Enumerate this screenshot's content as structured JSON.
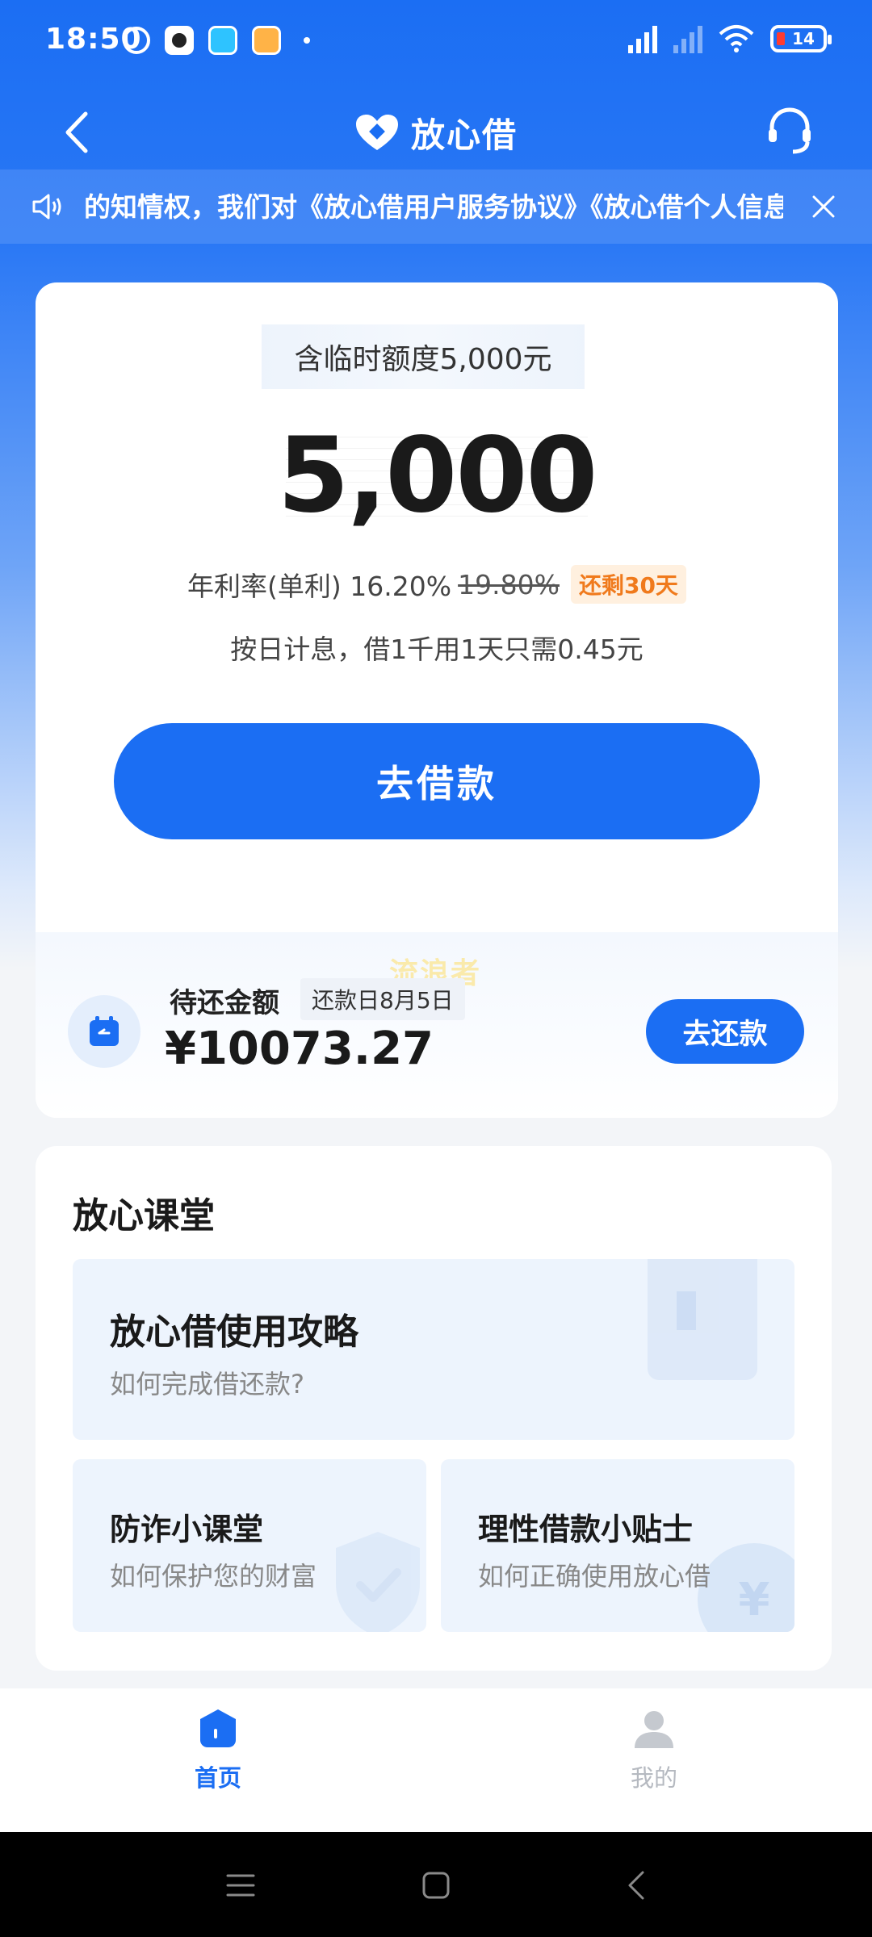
{
  "status_bar": {
    "time": "18:50",
    "battery": "14"
  },
  "nav": {
    "title": "放心借"
  },
  "notice": {
    "text": "的知情权，我们对《放心借用户服务协议》《放心借个人信息"
  },
  "credit": {
    "temp_limit_label": "含临时额度5,000元",
    "amount": "5,000",
    "rate_label": "年利率(单利) 16.20%",
    "rate_original": "19.80%",
    "rate_badge": "还剩30天",
    "interest_note": "按日计息，借1千用1天只需0.45元",
    "borrow_button": "去借款"
  },
  "repayment": {
    "watermark": "流浪者",
    "label": "待还金额",
    "due_date": "还款日8月5日",
    "amount": "¥10073.27",
    "button": "去还款"
  },
  "classroom": {
    "title": "放心课堂",
    "guide": {
      "title": "放心借使用攻略",
      "subtitle": "如何完成借还款?"
    },
    "anti_fraud": {
      "title": "防诈小课堂",
      "subtitle": "如何保护您的财富"
    },
    "tips": {
      "title": "理性借款小贴士",
      "subtitle": "如何正确使用放心借"
    },
    "coin_symbol": "¥"
  },
  "tabs": {
    "home": "首页",
    "mine": "我的"
  },
  "colors": {
    "brand_blue": "#1b6ef3",
    "badge_orange": "#f07a1c",
    "tab_inactive": "#b5b9c0"
  }
}
